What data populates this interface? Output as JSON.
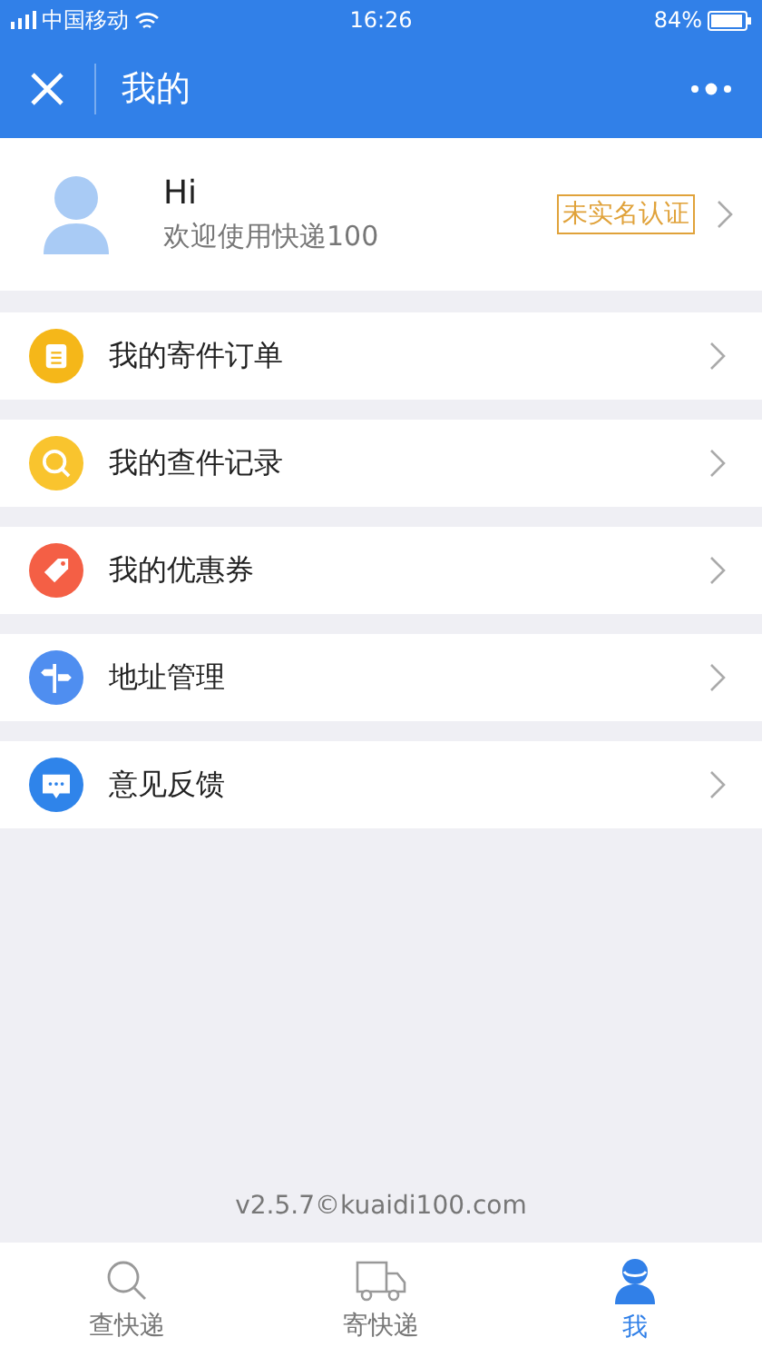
{
  "status_bar": {
    "carrier": "中国移动",
    "time": "16:26",
    "battery": "84%"
  },
  "nav": {
    "title": "我的"
  },
  "profile": {
    "greeting": "Hi",
    "subtitle": "欢迎使用快递100",
    "badge": "未实名认证"
  },
  "menu": [
    {
      "label": "我的寄件订单",
      "kind": "order",
      "color": "#f5b719"
    },
    {
      "label": "我的查件记录",
      "kind": "search",
      "color": "#f9c42e"
    },
    {
      "label": "我的优惠券",
      "kind": "coupon",
      "color": "#f45f45"
    },
    {
      "label": "地址管理",
      "kind": "address",
      "color": "#4f8ef0"
    },
    {
      "label": "意见反馈",
      "kind": "feedback",
      "color": "#2f84ea"
    }
  ],
  "version": "v2.5.7©kuaidi100.com",
  "tabs": [
    {
      "label": "查快递",
      "kind": "search",
      "selected": false
    },
    {
      "label": "寄快递",
      "kind": "truck",
      "selected": false
    },
    {
      "label": "我",
      "kind": "user",
      "selected": true
    }
  ]
}
